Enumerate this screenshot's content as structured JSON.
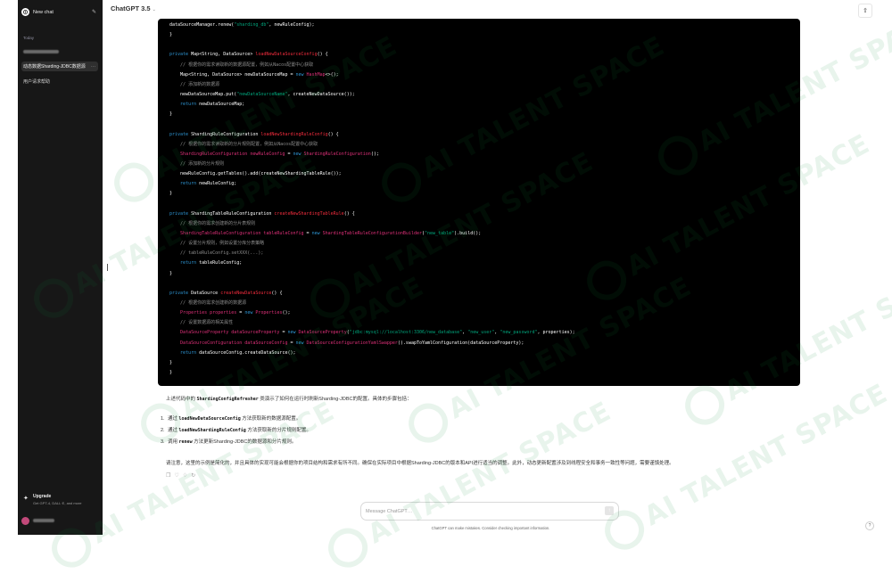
{
  "sidebar": {
    "new_chat_label": "New chat",
    "section_label": "Today",
    "items": [
      {
        "label": "动态数据Sharding-JDBC数据源",
        "active": true,
        "more": "···"
      },
      {
        "label": "用户请求帮助",
        "active": false
      }
    ],
    "upgrade": {
      "title": "Upgrade",
      "subtitle": "Get GPT-4, DALL·E, and more"
    }
  },
  "header": {
    "model_name": "ChatGPT 3.5",
    "model_chevron": "⌄",
    "share_icon": "share-icon"
  },
  "code": {
    "language": "java",
    "lines": [
      [
        [
          "dataSourceManager.renew(",
          "ty"
        ],
        [
          "\"sharding_db\"",
          "st"
        ],
        [
          ", newRuleConfig);",
          "ty"
        ]
      ],
      [
        [
          "}",
          "ty"
        ]
      ],
      [
        [
          "",
          ""
        ]
      ],
      [
        [
          "private ",
          "kw"
        ],
        [
          "Map<String, DataSource> ",
          "ty"
        ],
        [
          "loadNewDataSourceConfig",
          "fn"
        ],
        [
          "() {",
          "ty"
        ]
      ],
      [
        [
          "    // 根据你的需求读取新的数据源配置，例如从Nacos配置中心获取",
          "cm"
        ]
      ],
      [
        [
          "    Map<String, DataSource> newDataSourceMap = ",
          "ty"
        ],
        [
          "new ",
          "kw"
        ],
        [
          "HashMap",
          "vr"
        ],
        [
          "<>();",
          "ty"
        ]
      ],
      [
        [
          "    // 添加新的数据源",
          "cm"
        ]
      ],
      [
        [
          "    newDataSourceMap.put(",
          "ty"
        ],
        [
          "\"newDataSourceName\"",
          "st"
        ],
        [
          ", createNewDataSource());",
          "ty"
        ]
      ],
      [
        [
          "    ",
          "ty"
        ],
        [
          "return ",
          "kw"
        ],
        [
          "newDataSourceMap;",
          "ty"
        ]
      ],
      [
        [
          "}",
          "ty"
        ]
      ],
      [
        [
          "",
          ""
        ]
      ],
      [
        [
          "private ",
          "kw"
        ],
        [
          "ShardingRuleConfiguration ",
          "ty"
        ],
        [
          "loadNewShardingRuleConfig",
          "fn"
        ],
        [
          "() {",
          "ty"
        ]
      ],
      [
        [
          "    // 根据你的需求读取新的分片规则配置，例如从Nacos配置中心获取",
          "cm"
        ]
      ],
      [
        [
          "    ",
          "ty"
        ],
        [
          "ShardingRuleConfiguration newRuleConfig ",
          "vr"
        ],
        [
          "= ",
          "ty"
        ],
        [
          "new ",
          "kw"
        ],
        [
          "ShardingRuleConfiguration",
          "vr"
        ],
        [
          "();",
          "ty"
        ]
      ],
      [
        [
          "    // 添加新的分片规则",
          "cm"
        ]
      ],
      [
        [
          "    newRuleConfig.getTables().add(createNewShardingTableRule());",
          "ty"
        ]
      ],
      [
        [
          "    ",
          "ty"
        ],
        [
          "return ",
          "kw"
        ],
        [
          "newRuleConfig;",
          "ty"
        ]
      ],
      [
        [
          "}",
          "ty"
        ]
      ],
      [
        [
          "",
          ""
        ]
      ],
      [
        [
          "private ",
          "kw"
        ],
        [
          "ShardingTableRuleConfiguration ",
          "ty"
        ],
        [
          "createNewShardingTableRule",
          "fn"
        ],
        [
          "() {",
          "ty"
        ]
      ],
      [
        [
          "    // 根据你的需求创建新的分片表规则",
          "cm"
        ]
      ],
      [
        [
          "    ",
          "ty"
        ],
        [
          "ShardingTableRuleConfiguration tableRuleConfig ",
          "vr"
        ],
        [
          "= ",
          "ty"
        ],
        [
          "new ",
          "kw"
        ],
        [
          "ShardingTableRuleConfigurationBuilder",
          "vr"
        ],
        [
          "(",
          "ty"
        ],
        [
          "\"new_table\"",
          "st"
        ],
        [
          ").build();",
          "ty"
        ]
      ],
      [
        [
          "    // 设置分片规则，例如设置分库分表策略",
          "cm"
        ]
      ],
      [
        [
          "    // tableRuleConfig.setXXX(...);",
          "cm"
        ]
      ],
      [
        [
          "    ",
          "ty"
        ],
        [
          "return ",
          "kw"
        ],
        [
          "tableRuleConfig;",
          "ty"
        ]
      ],
      [
        [
          "}",
          "ty"
        ]
      ],
      [
        [
          "",
          ""
        ]
      ],
      [
        [
          "private ",
          "kw"
        ],
        [
          "DataSource ",
          "ty"
        ],
        [
          "createNewDataSource",
          "fn"
        ],
        [
          "() {",
          "ty"
        ]
      ],
      [
        [
          "    // 根据你的需求创建新的数据源",
          "cm"
        ]
      ],
      [
        [
          "    ",
          "ty"
        ],
        [
          "Properties properties ",
          "vr"
        ],
        [
          "= ",
          "ty"
        ],
        [
          "new ",
          "kw"
        ],
        [
          "Properties",
          "vr"
        ],
        [
          "();",
          "ty"
        ]
      ],
      [
        [
          "    // 设置数据源的相关属性",
          "cm"
        ]
      ],
      [
        [
          "    ",
          "ty"
        ],
        [
          "DataSourceProperty dataSourceProperty ",
          "vr"
        ],
        [
          "= ",
          "ty"
        ],
        [
          "new ",
          "kw"
        ],
        [
          "DataSourceProperty",
          "vr"
        ],
        [
          "(",
          "ty"
        ],
        [
          "\"jdbc:mysql://localhost:3306/new_database\"",
          "st"
        ],
        [
          ", ",
          "ty"
        ],
        [
          "\"new_user\"",
          "st"
        ],
        [
          ", ",
          "ty"
        ],
        [
          "\"new_password\"",
          "st"
        ],
        [
          ", properties);",
          "ty"
        ]
      ],
      [
        [
          "    ",
          "ty"
        ],
        [
          "DataSourceConfiguration dataSourceConfig ",
          "vr"
        ],
        [
          "= ",
          "ty"
        ],
        [
          "new ",
          "kw"
        ],
        [
          "DataSourceConfigurationYamlSwapper",
          "vr"
        ],
        [
          "().swapToYamlConfiguration(dataSourceProperty);",
          "ty"
        ]
      ],
      [
        [
          "    ",
          "ty"
        ],
        [
          "return ",
          "kw"
        ],
        [
          "dataSourceConfig.createDataSource();",
          "ty"
        ]
      ],
      [
        [
          "}",
          "ty"
        ]
      ],
      [
        [
          "}",
          "ty"
        ]
      ]
    ]
  },
  "answer": {
    "intro": {
      "pre": "上述代码中的 ",
      "code": "ShardingConfigRefresher",
      "post": " 类演示了如何在运行时刷新Sharding-JDBC的配置。具体的步骤包括："
    },
    "steps": [
      {
        "num": "1.",
        "pre": "通过 ",
        "code": "loadNewDataSourceConfig",
        "post": " 方法获取新的数据源配置。"
      },
      {
        "num": "2.",
        "pre": "通过 ",
        "code": "loadNewShardingRuleConfig",
        "post": " 方法获取新的分片规则配置。"
      },
      {
        "num": "3.",
        "pre": "调用 ",
        "code": "renew",
        "post": " 方法更新Sharding-JDBC的数据源和分片规则。"
      }
    ],
    "note": "请注意，这里的示例是简化的，并且具体的实现可能会根据你的项目结构和需求有所不同。确保在实际项目中根据Sharding-JDBC的版本和API进行适当的调整。此外，动态更新配置涉及到线程安全和事务一致性等问题，需要谨慎处理。",
    "action_icons": [
      "copy-icon",
      "thumbs-up-icon",
      "thumbs-down-icon",
      "regenerate-icon"
    ]
  },
  "composer": {
    "placeholder": "Message ChatGPT…",
    "send_icon": "arrow-up-icon"
  },
  "disclaimer": "ChatGPT can make mistakes. Consider checking important information.",
  "help": "?",
  "watermark": {
    "text": "AI TALENT SPACE",
    "color": "#0c8c3a"
  }
}
